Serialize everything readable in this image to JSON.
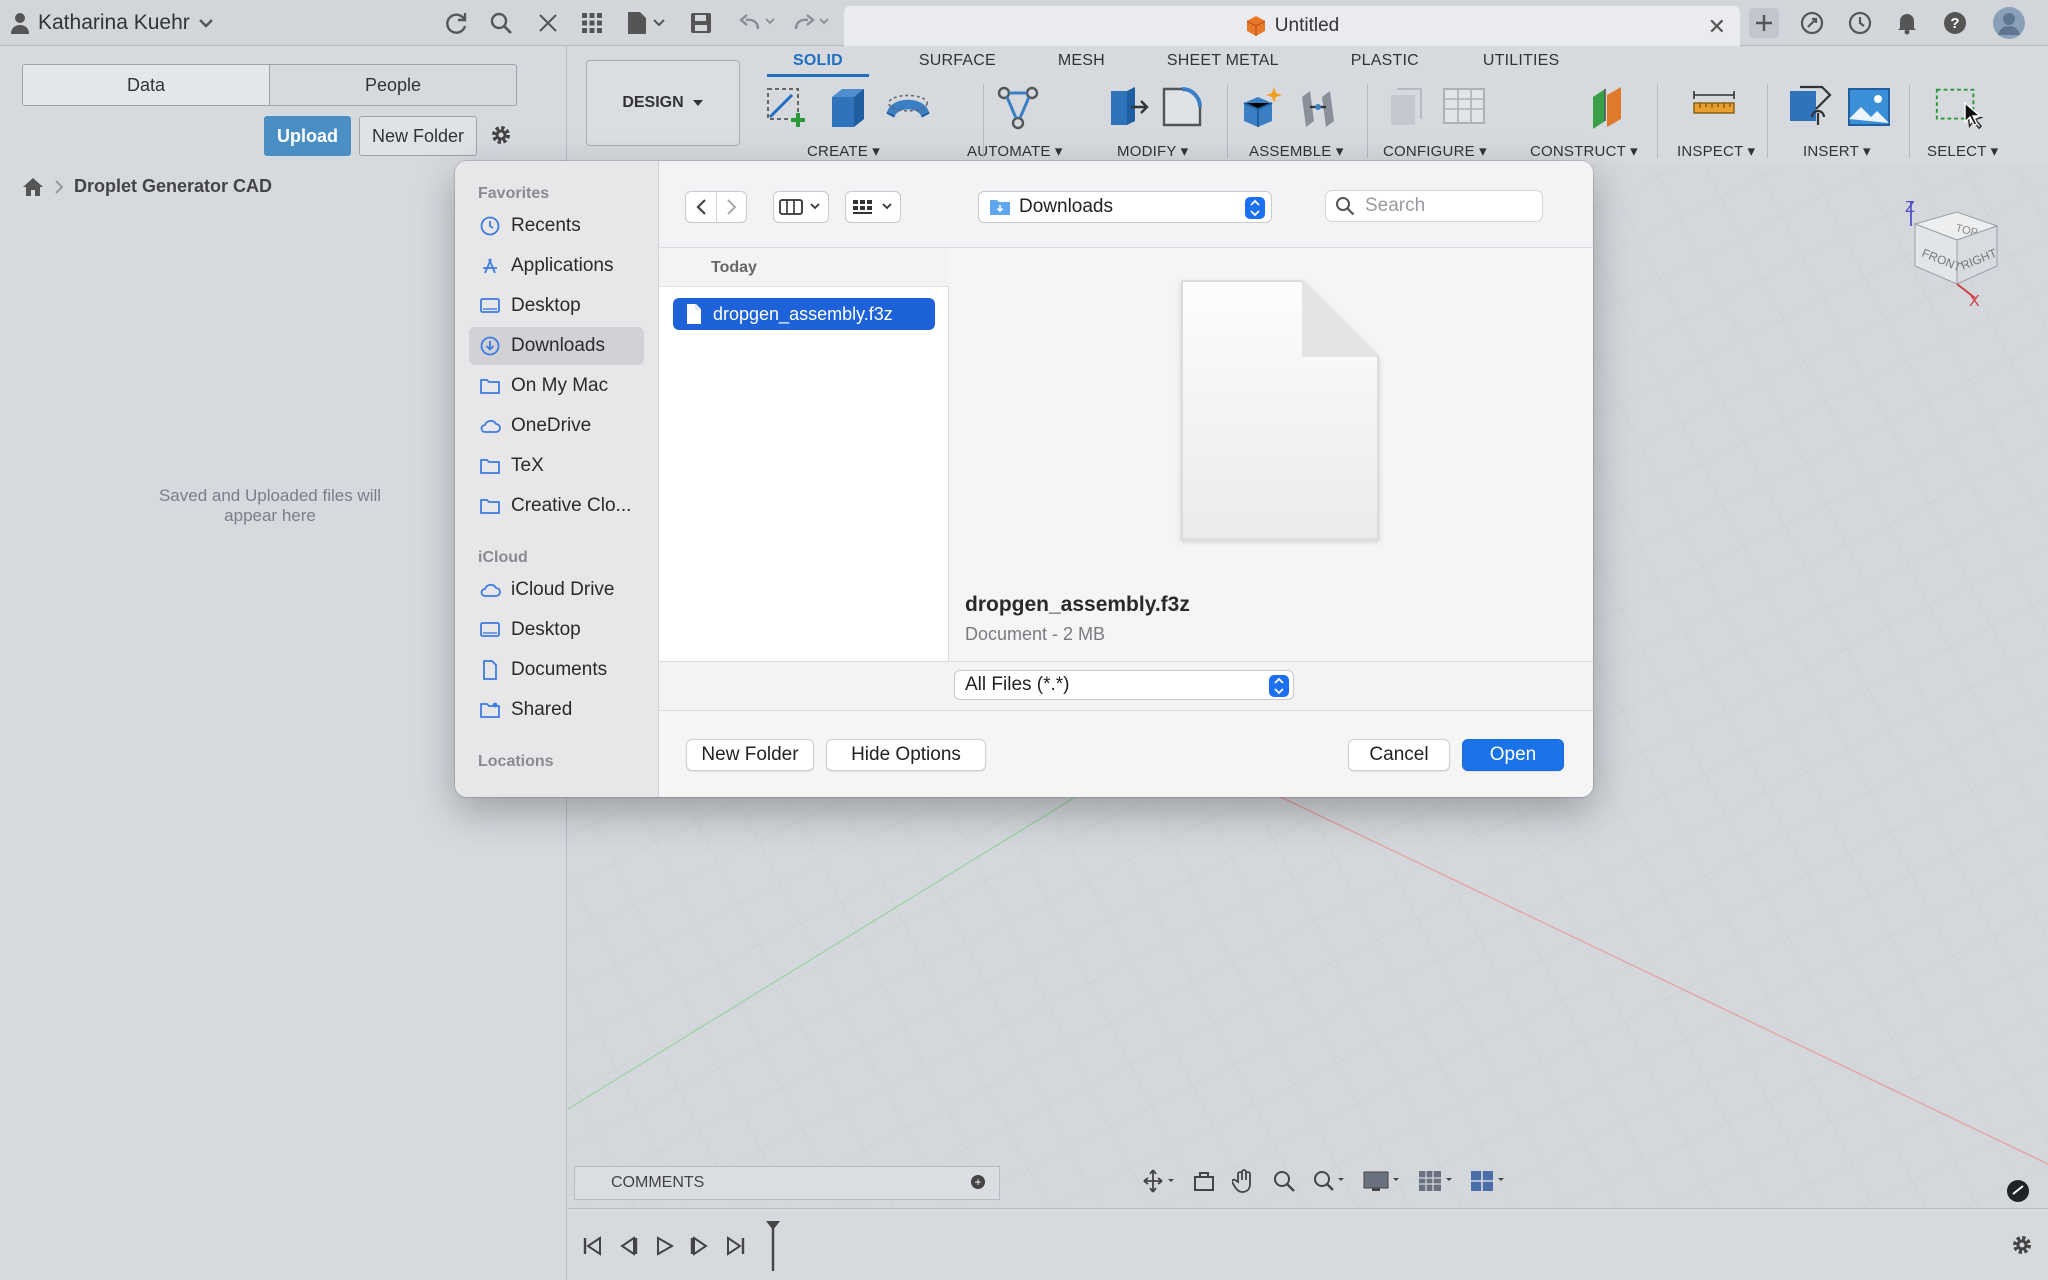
{
  "topbar": {
    "user_name": "Katharina Kuehr",
    "document_title": "Untitled",
    "icons": [
      "refresh-icon",
      "search-icon",
      "close-icon",
      "grid-icon",
      "file-icon",
      "save-icon",
      "undo-icon",
      "redo-icon",
      "add-tab-icon",
      "extensions-icon",
      "job-status-icon",
      "notifications-icon",
      "help-icon",
      "profile-icon"
    ]
  },
  "data_panel": {
    "tabs": [
      "Data",
      "People"
    ],
    "upload_label": "Upload",
    "new_folder_label": "New Folder",
    "breadcrumb": "Droplet Generator CAD",
    "empty_message": "Saved and Uploaded files will appear here"
  },
  "toolbar": {
    "workspace": "DESIGN",
    "tabs": [
      "SOLID",
      "SURFACE",
      "MESH",
      "SHEET METAL",
      "PLASTIC",
      "UTILITIES"
    ],
    "active_tab": "SOLID",
    "groups": [
      "CREATE",
      "AUTOMATE",
      "MODIFY",
      "ASSEMBLE",
      "CONFIGURE",
      "CONSTRUCT",
      "INSPECT",
      "INSERT",
      "SELECT"
    ]
  },
  "viewcube": {
    "axis_z": "Z",
    "axis_x": "X",
    "faces": [
      "TOP",
      "FRONT",
      "RIGHT"
    ]
  },
  "bottom": {
    "comments_label": "COMMENTS"
  },
  "dialog": {
    "sidebar": {
      "favorites_heading": "Favorites",
      "favorites": [
        "Recents",
        "Applications",
        "Desktop",
        "Downloads",
        "On My Mac",
        "OneDrive",
        "TeX",
        "Creative Clo..."
      ],
      "selected": "Downloads",
      "icloud_heading": "iCloud",
      "icloud": [
        "iCloud Drive",
        "Desktop",
        "Documents",
        "Shared"
      ],
      "locations_heading": "Locations"
    },
    "location": "Downloads",
    "search_placeholder": "Search",
    "column_heading": "Today",
    "file_name": "dropgen_assembly.f3z",
    "preview_name": "dropgen_assembly.f3z",
    "preview_meta": "Document - 2 MB",
    "filter": "All Files (*.*)",
    "new_folder_label": "New Folder",
    "hide_options_label": "Hide Options",
    "cancel_label": "Cancel",
    "open_label": "Open"
  },
  "colors": {
    "accent": "#1a73e8",
    "selection": "#1d62d9",
    "active_tab": "#1f6fbf",
    "upload": "#4a8fc3"
  }
}
